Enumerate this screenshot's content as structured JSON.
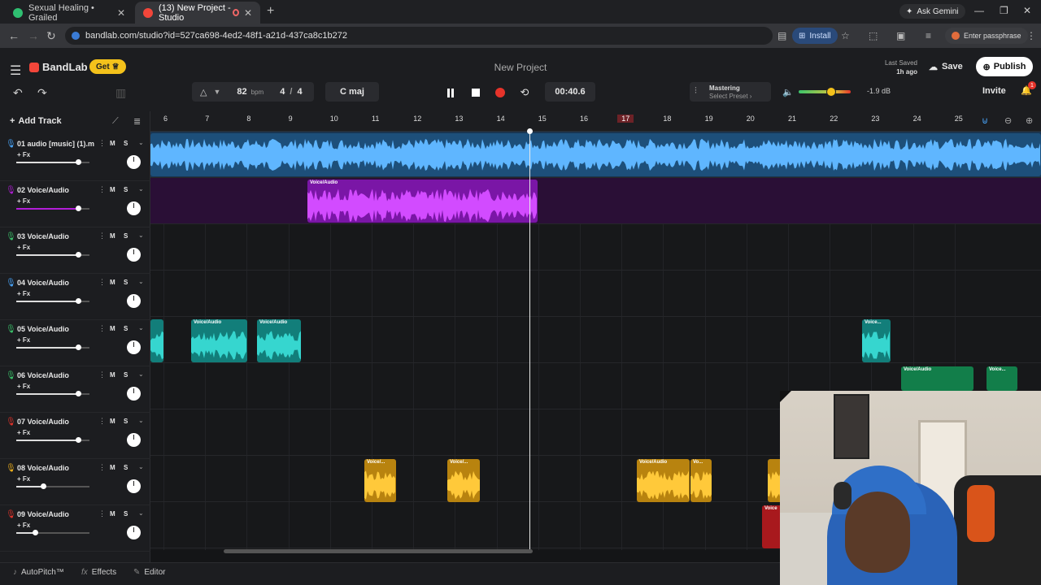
{
  "browser": {
    "tabs": [
      {
        "title": "Sexual Healing • Grailed",
        "favicon_color": "#2fbf71"
      },
      {
        "title": "(13) New Project - Studio",
        "favicon_color": "#f2463a"
      }
    ],
    "url": "bandlab.com/studio?id=527ca698-4ed2-48f1-a21d-437ca8c1b272",
    "ask_gemini": "Ask Gemini",
    "install": "Install",
    "passphrase": "Enter passphrase"
  },
  "app": {
    "brand": "BandLab",
    "get": "Get",
    "project_title": "New Project",
    "last_saved_label": "Last Saved",
    "last_saved_time": "1h ago",
    "save": "Save",
    "publish": "Publish",
    "invite": "Invite",
    "notifications_count": "1"
  },
  "transport": {
    "bpm": "82",
    "bpm_unit": "bpm",
    "time_sig_num": "4",
    "time_sig_den": "4",
    "key": "C maj",
    "time": "00:40.6",
    "mastering_title": "Mastering",
    "mastering_preset": "Select Preset",
    "master_db": "-1.9 dB",
    "master_volume_fraction": 0.62
  },
  "tracks_panel": {
    "add_track": "Add Track",
    "fx_label": "+ Fx",
    "mute": "M",
    "solo": "S",
    "tracks": [
      {
        "name": "01  audio [music] (1).m...",
        "color": "#4aa8ff",
        "volume": 0.84
      },
      {
        "name": "02  Voice/Audio",
        "color": "#b21ed8",
        "volume": 0.84
      },
      {
        "name": "03  Voice/Audio",
        "color": "#3bc46b",
        "volume": 0.84
      },
      {
        "name": "04  Voice/Audio",
        "color": "#4aa8ff",
        "volume": 0.84
      },
      {
        "name": "05  Voice/Audio",
        "color": "#3bc46b",
        "volume": 0.84
      },
      {
        "name": "06  Voice/Audio",
        "color": "#3bc46b",
        "volume": 0.84
      },
      {
        "name": "07  Voice/Audio",
        "color": "#e6332a",
        "volume": 0.84
      },
      {
        "name": "08  Voice/Audio",
        "color": "#f4b41b",
        "volume": 0.37
      },
      {
        "name": "09  Voice/Audio",
        "color": "#e6332a",
        "volume": 0.26
      }
    ]
  },
  "timeline": {
    "bars": [
      "6",
      "7",
      "8",
      "9",
      "10",
      "11",
      "12",
      "13",
      "14",
      "15",
      "16",
      "17",
      "18",
      "19",
      "20",
      "21",
      "22",
      "23",
      "24",
      "25"
    ],
    "highlight_bar": "17",
    "clip_labels": {
      "purple": "Voice/Audio",
      "teal_a": "Voice/Audio",
      "teal_b": "Voice/Audio",
      "teal_c": "Voice...",
      "teal_d": "Voice/Audio",
      "teal_e": "Voice...",
      "yellow_a": "Voice/...",
      "yellow_b": "Voice/...",
      "yellow_c": "Voice/Audio",
      "yellow_d": "Vo...",
      "red_a": "Voice"
    }
  },
  "bottom": {
    "autopitch": "AutoPitch™",
    "effects": "Effects",
    "editor": "Editor"
  }
}
